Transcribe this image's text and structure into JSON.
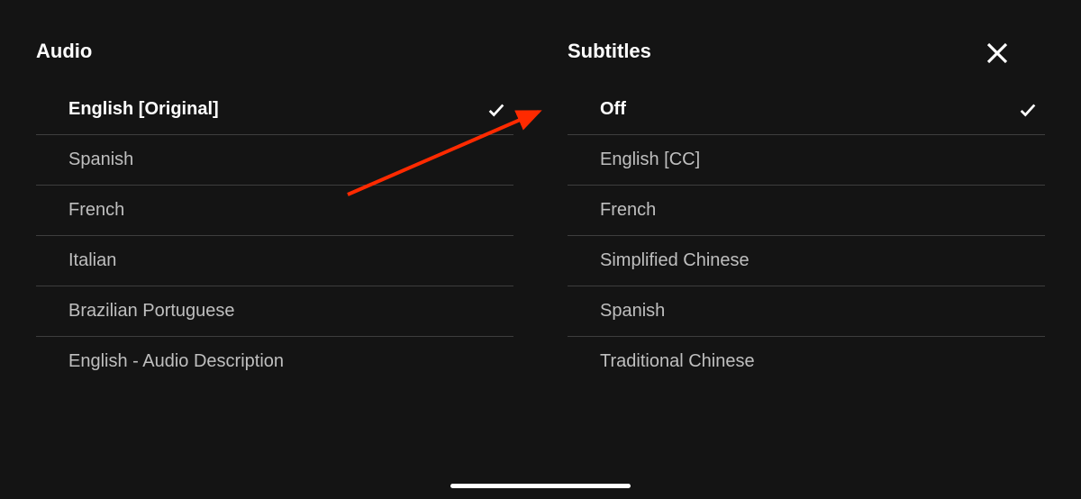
{
  "audio": {
    "header": "Audio",
    "options": [
      {
        "label": "English [Original]",
        "selected": true
      },
      {
        "label": "Spanish",
        "selected": false
      },
      {
        "label": "French",
        "selected": false
      },
      {
        "label": "Italian",
        "selected": false
      },
      {
        "label": "Brazilian Portuguese",
        "selected": false
      },
      {
        "label": "English - Audio Description",
        "selected": false
      }
    ]
  },
  "subtitles": {
    "header": "Subtitles",
    "options": [
      {
        "label": "Off",
        "selected": true
      },
      {
        "label": "English [CC]",
        "selected": false
      },
      {
        "label": "French",
        "selected": false
      },
      {
        "label": "Simplified Chinese",
        "selected": false
      },
      {
        "label": "Spanish",
        "selected": false
      },
      {
        "label": "Traditional Chinese",
        "selected": false
      }
    ]
  }
}
